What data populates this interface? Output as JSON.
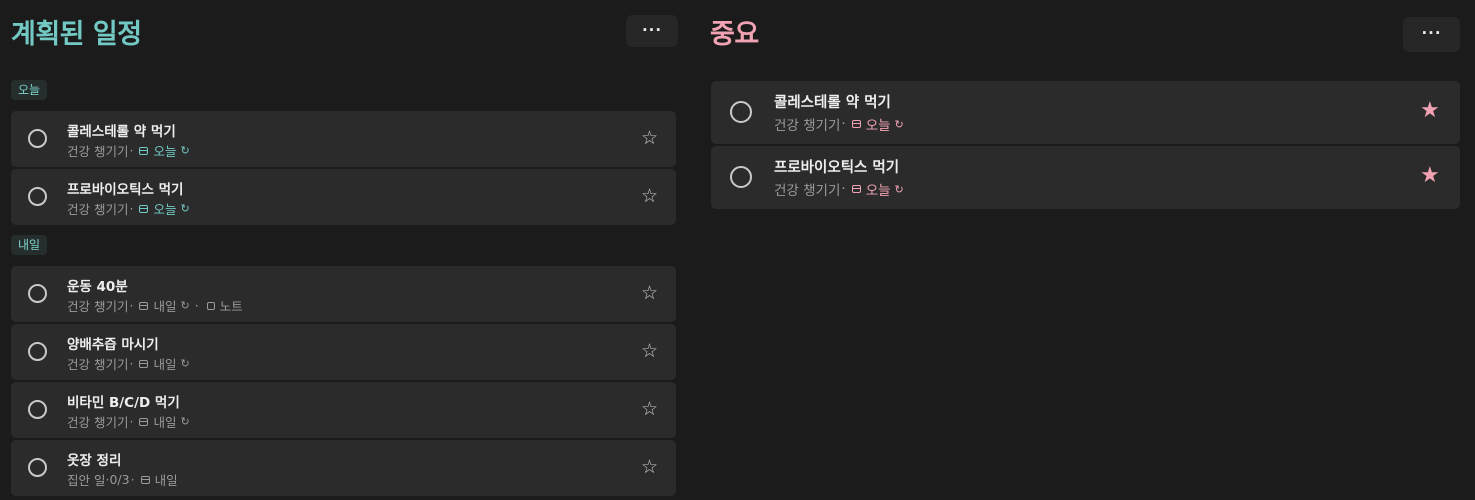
{
  "left": {
    "title": "계획된 일정",
    "more": "···",
    "groups": [
      {
        "label": "오늘",
        "tasks": [
          {
            "title": "콜레스테롤 약 먹기",
            "list": "건강 챙기기",
            "sep": "·",
            "date": "오늘",
            "repeat": "↻"
          },
          {
            "title": "프로바이오틱스 먹기",
            "list": "건강 챙기기",
            "sep": "·",
            "date": "오늘",
            "repeat": "↻"
          }
        ]
      },
      {
        "label": "내일",
        "tasks": [
          {
            "title": "운동 40분",
            "list": "건강 챙기기",
            "sep": "·",
            "date": "내일",
            "repeat": "↻",
            "sep2": "·",
            "note": "노트"
          },
          {
            "title": "양배추즙 마시기",
            "list": "건강 챙기기",
            "sep": "·",
            "date": "내일",
            "repeat": "↻"
          },
          {
            "title": "비타민 B/C/D 먹기",
            "list": "건강 챙기기",
            "sep": "·",
            "date": "내일",
            "repeat": "↻"
          },
          {
            "title": "옷장 정리",
            "list": "집안 일",
            "sep": "·",
            "steps": "0/3",
            "sep3": "·",
            "date": "내일"
          }
        ]
      }
    ],
    "star_icon": "☆"
  },
  "right": {
    "title": "중요",
    "more": "···",
    "tasks": [
      {
        "title": "콜레스테롤 약 먹기",
        "list": "건강 챙기기",
        "sep": "·",
        "date": "오늘",
        "repeat": "↻"
      },
      {
        "title": "프로바이오틱스 먹기",
        "list": "건강 챙기기",
        "sep": "·",
        "date": "오늘",
        "repeat": "↻"
      }
    ],
    "star_icon": "★"
  },
  "colors": {
    "planned_accent": "#72c9c4",
    "important_accent": "#f2a3b3",
    "background": "#1b1b1b",
    "card": "#2b2b2b"
  }
}
